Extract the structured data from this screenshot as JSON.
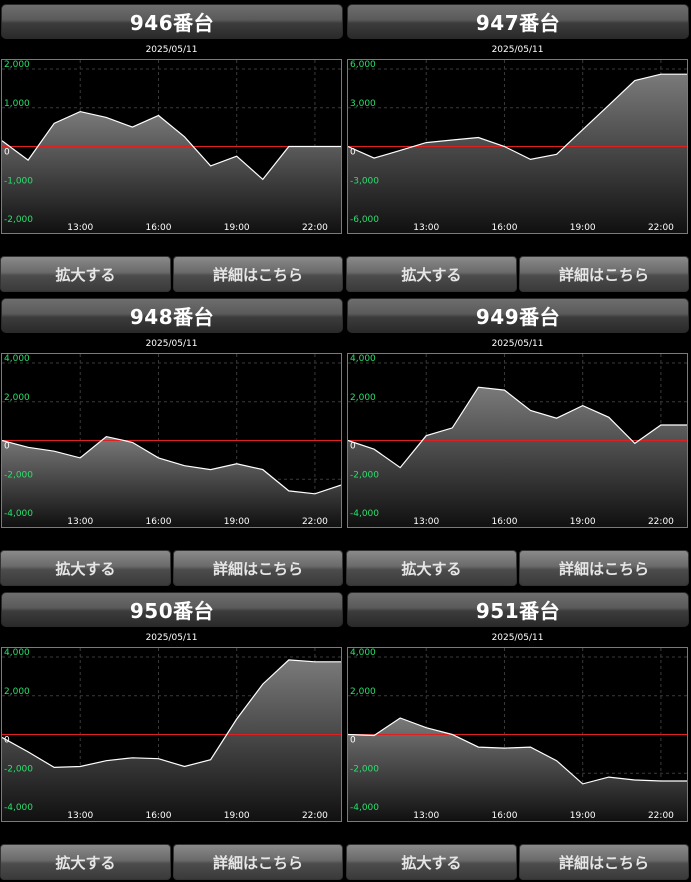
{
  "labels": {
    "expand_button": "拡大する",
    "details_button": "詳細はこちら"
  },
  "colors": {
    "axis_label": "#27e06a",
    "zero_line": "#e02020",
    "series_line": "#ffffff"
  },
  "chart_data": [
    {
      "type": "area",
      "title": "946番台",
      "date": "2025/05/11",
      "y_ticks": [
        2000,
        1000,
        0,
        -1000,
        -2000
      ],
      "y_tick_labels": [
        "2,000",
        "1,000",
        "0",
        "-1,000",
        "-2,000"
      ],
      "ylim": [
        -2000,
        2000
      ],
      "x_ticks": [
        13,
        16,
        19,
        22
      ],
      "x_tick_labels": [
        "13:00",
        "16:00",
        "19:00",
        "22:00"
      ],
      "x": [
        10,
        11,
        12,
        13,
        14,
        15,
        16,
        17,
        18,
        19,
        20,
        21,
        22,
        23
      ],
      "values": [
        150,
        -350,
        600,
        900,
        750,
        500,
        800,
        250,
        -500,
        -250,
        -850,
        0,
        0,
        0
      ]
    },
    {
      "type": "area",
      "title": "947番台",
      "date": "2025/05/11",
      "y_ticks": [
        6000,
        3000,
        0,
        -3000,
        -6000
      ],
      "y_tick_labels": [
        "6,000",
        "3,000",
        "0",
        "-3,000",
        "-6,000"
      ],
      "ylim": [
        -6000,
        6000
      ],
      "x_ticks": [
        13,
        16,
        19,
        22
      ],
      "x_tick_labels": [
        "13:00",
        "16:00",
        "19:00",
        "22:00"
      ],
      "x": [
        10,
        11,
        12,
        13,
        14,
        15,
        16,
        17,
        18,
        19,
        20,
        21,
        22,
        23
      ],
      "values": [
        0,
        -900,
        -300,
        300,
        500,
        700,
        0,
        -1000,
        -600,
        1300,
        3200,
        5100,
        5600,
        5600
      ]
    },
    {
      "type": "area",
      "title": "948番台",
      "date": "2025/05/11",
      "y_ticks": [
        4000,
        2000,
        0,
        -2000,
        -4000
      ],
      "y_tick_labels": [
        "4,000",
        "2,000",
        "0",
        "-2,000",
        "-4,000"
      ],
      "ylim": [
        -4000,
        4000
      ],
      "x_ticks": [
        13,
        16,
        19,
        22
      ],
      "x_tick_labels": [
        "13:00",
        "16:00",
        "19:00",
        "22:00"
      ],
      "x": [
        10,
        11,
        12,
        13,
        14,
        15,
        16,
        17,
        18,
        19,
        20,
        21,
        22,
        23
      ],
      "values": [
        0,
        -350,
        -550,
        -900,
        200,
        -100,
        -900,
        -1300,
        -1500,
        -1200,
        -1500,
        -2600,
        -2750,
        -2300
      ]
    },
    {
      "type": "area",
      "title": "949番台",
      "date": "2025/05/11",
      "y_ticks": [
        4000,
        2000,
        0,
        -2000,
        -4000
      ],
      "y_tick_labels": [
        "4,000",
        "2,000",
        "0",
        "-2,000",
        "-4,000"
      ],
      "ylim": [
        -4000,
        4000
      ],
      "x_ticks": [
        13,
        16,
        19,
        22
      ],
      "x_tick_labels": [
        "13:00",
        "16:00",
        "19:00",
        "22:00"
      ],
      "x": [
        10,
        11,
        12,
        13,
        14,
        15,
        16,
        17,
        18,
        19,
        20,
        21,
        22,
        23
      ],
      "values": [
        0,
        -450,
        -1400,
        250,
        650,
        2750,
        2600,
        1550,
        1150,
        1800,
        1200,
        -150,
        800,
        800
      ]
    },
    {
      "type": "area",
      "title": "950番台",
      "date": "2025/05/11",
      "y_ticks": [
        4000,
        2000,
        0,
        -2000,
        -4000
      ],
      "y_tick_labels": [
        "4,000",
        "2,000",
        "0",
        "-2,000",
        "-4,000"
      ],
      "ylim": [
        -4000,
        4000
      ],
      "x_ticks": [
        13,
        16,
        19,
        22
      ],
      "x_tick_labels": [
        "13:00",
        "16:00",
        "19:00",
        "22:00"
      ],
      "x": [
        10,
        11,
        12,
        13,
        14,
        15,
        16,
        17,
        18,
        19,
        20,
        21,
        22,
        23
      ],
      "values": [
        -150,
        -900,
        -1700,
        -1650,
        -1350,
        -1200,
        -1250,
        -1650,
        -1300,
        800,
        2600,
        3850,
        3750,
        3750
      ]
    },
    {
      "type": "area",
      "title": "951番台",
      "date": "2025/05/11",
      "y_ticks": [
        4000,
        2000,
        0,
        -2000,
        -4000
      ],
      "y_tick_labels": [
        "4,000",
        "2,000",
        "0",
        "-2,000",
        "-4,000"
      ],
      "ylim": [
        -4000,
        4000
      ],
      "x_ticks": [
        13,
        16,
        19,
        22
      ],
      "x_tick_labels": [
        "13:00",
        "16:00",
        "19:00",
        "22:00"
      ],
      "x": [
        10,
        11,
        12,
        13,
        14,
        15,
        16,
        17,
        18,
        19,
        20,
        21,
        22,
        23
      ],
      "values": [
        0,
        -50,
        850,
        350,
        0,
        -650,
        -700,
        -650,
        -1350,
        -2550,
        -2200,
        -2350,
        -2400,
        -2400
      ]
    }
  ]
}
